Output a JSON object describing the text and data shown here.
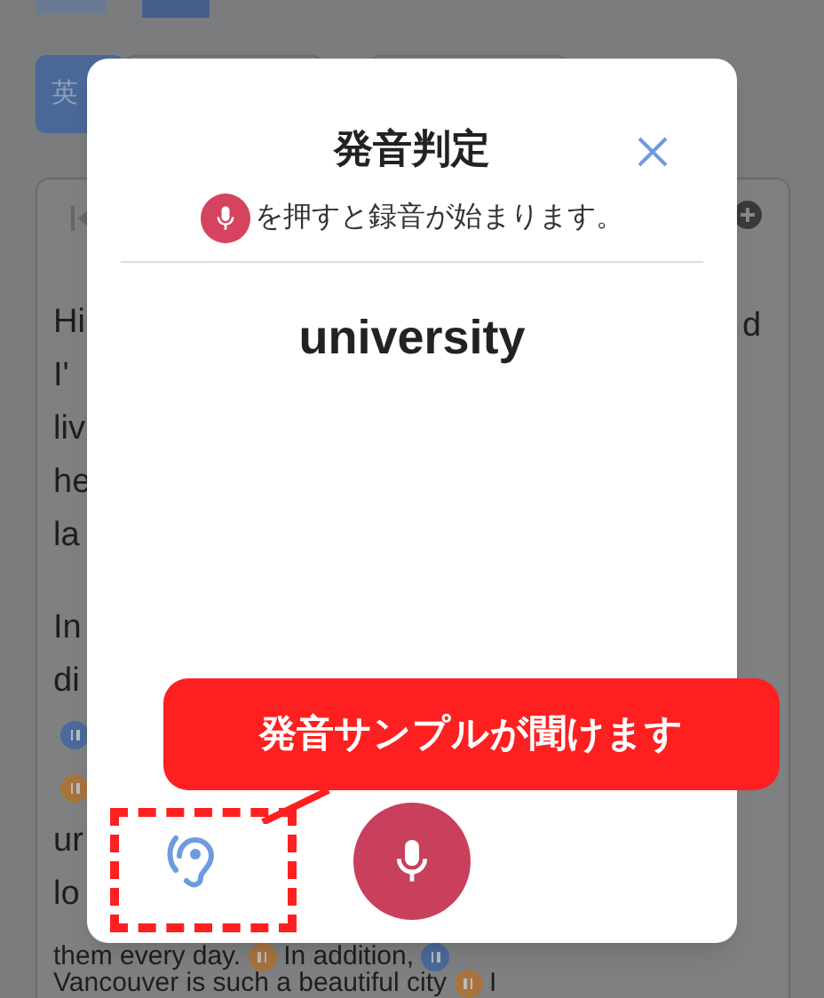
{
  "background": {
    "tabs": [
      {
        "label": "英",
        "selected": true
      }
    ],
    "paragraphs": [
      [
        [
          {
            "kind": "text",
            "text": "Hi"
          }
        ],
        [
          {
            "kind": "text",
            "text": "I'"
          }
        ],
        [
          {
            "kind": "text",
            "text": "liv"
          }
        ],
        [
          {
            "kind": "text",
            "text": "he"
          }
        ],
        [
          {
            "kind": "text",
            "text": "la"
          }
        ]
      ],
      [
        [
          {
            "kind": "text",
            "text": "In"
          }
        ],
        [
          {
            "kind": "text",
            "text": "di"
          }
        ],
        [
          {
            "kind": "marker",
            "color": "#4a6a9c"
          }
        ],
        [
          {
            "kind": "marker",
            "color": "#a8743e"
          }
        ],
        [
          {
            "kind": "text",
            "text": "ur"
          }
        ],
        [
          {
            "kind": "text",
            "text": "lo"
          }
        ]
      ]
    ],
    "bottom_lines": [
      [
        {
          "kind": "text",
          "text": "them every day."
        },
        {
          "kind": "marker",
          "color": "#a8743e"
        },
        {
          "kind": "text",
          "text": "In addition,"
        },
        {
          "kind": "marker",
          "color": "#4a6a9c"
        }
      ],
      [
        {
          "kind": "text",
          "text": "Vancouver is such a beautiful city"
        },
        {
          "kind": "marker",
          "color": "#a8743e"
        },
        {
          "kind": "text",
          "text": "I"
        }
      ]
    ],
    "right_text": "d"
  },
  "modal": {
    "title": "発音判定",
    "hint": "を押すと録音が始まります。",
    "word": "university"
  },
  "callout": {
    "text": "発音サンプルが聞けます"
  }
}
